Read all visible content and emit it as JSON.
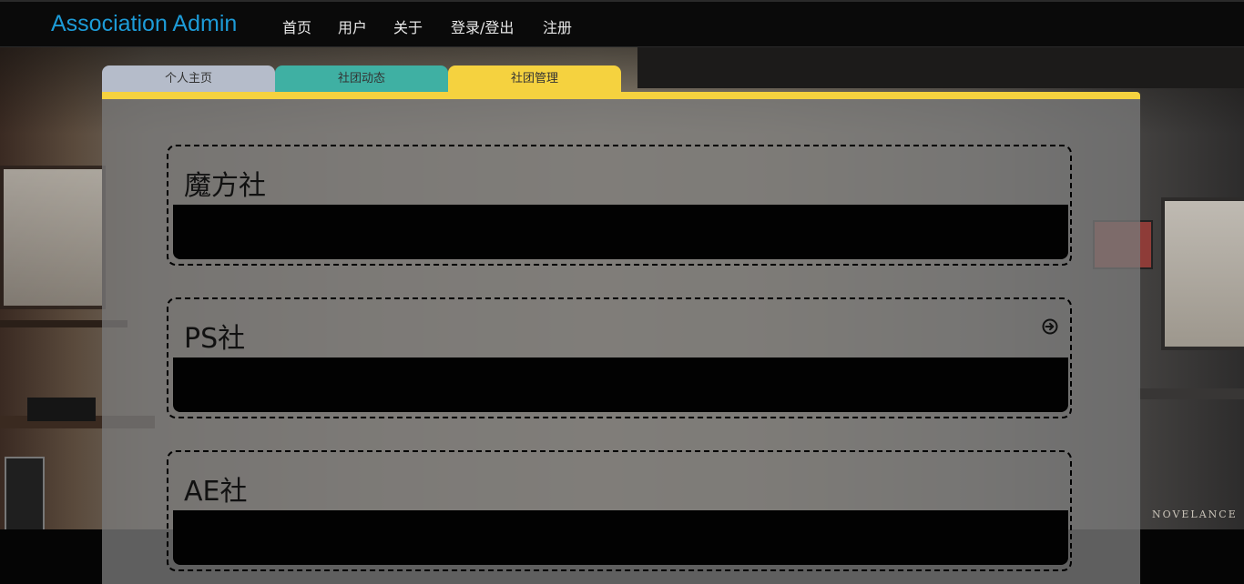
{
  "navbar": {
    "brand": "Association Admin",
    "links": [
      "首页",
      "用户",
      "关于",
      "登录/登出",
      "注册"
    ]
  },
  "tabs": [
    "个人主页",
    "社团动态",
    "社团管理"
  ],
  "clubs": [
    {
      "name": "魔方社"
    },
    {
      "name": "PS社"
    },
    {
      "name": "AE社"
    }
  ],
  "background": {
    "watermark": "NOVELANCE"
  },
  "colors": {
    "brand": "#1d9bd7",
    "tab_personal": "#b5bcca",
    "tab_news": "#3fb0a3",
    "tab_manage": "#f5d23f"
  },
  "icons": {
    "enter": "arrow-circle-right-icon"
  }
}
